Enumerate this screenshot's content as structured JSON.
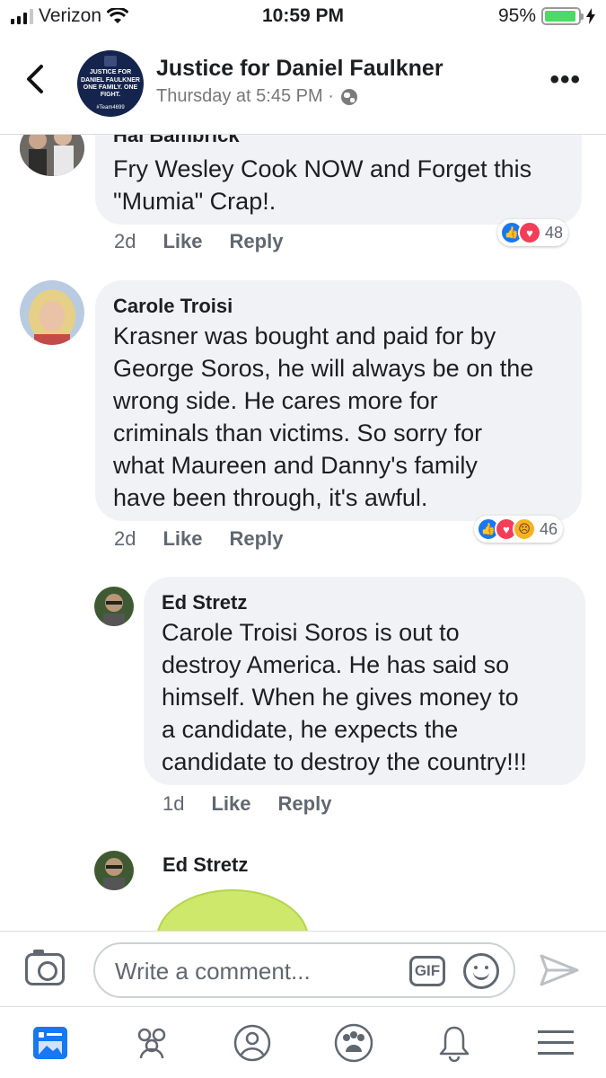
{
  "status_bar": {
    "carrier": "Verizon",
    "time": "10:59 PM",
    "battery": "95%",
    "battery_level": 0.95
  },
  "header": {
    "title": "Justice for Daniel Faulkner",
    "subtitle": "Thursday at 5:45 PM ·",
    "avatar_lines": [
      "JUSTICE FOR DANIEL FAULKNER",
      "ONE FAMILY. ONE FIGHT.",
      "#Team4699"
    ]
  },
  "comments": [
    {
      "name": "Hal Bambrick",
      "text_lines": [
        "Fry Wesley Cook NOW and Forget this",
        "\"Mumia\" Crap!."
      ],
      "age": "2d",
      "like": "Like",
      "reply": "Reply",
      "reactions": [
        "like-icon",
        "love-icon"
      ],
      "reaction_count": "48"
    },
    {
      "name": "Carole Troisi",
      "text_lines": [
        "Krasner was bought and paid for by",
        "George Soros, he will always be on the",
        "wrong side.  He cares more for",
        "criminals than victims.  So sorry for",
        "what Maureen and Danny's family",
        "have been through, it's awful."
      ],
      "age": "2d",
      "like": "Like",
      "reply": "Reply",
      "reactions": [
        "like-icon",
        "love-icon",
        "sad-icon"
      ],
      "reaction_count": "46"
    },
    {
      "name": "Ed Stretz",
      "text_lines": [
        "Carole Troisi Soros is out to",
        "destroy America. He has said so",
        "himself. When he gives money to",
        "a candidate, he expects the",
        "candidate to destroy the country!!!"
      ],
      "age": "1d",
      "like": "Like",
      "reply": "Reply"
    },
    {
      "name": "Ed Stretz"
    }
  ],
  "composer": {
    "placeholder": "Write a comment...",
    "gif": "GIF"
  },
  "tabs": [
    "news-feed-icon",
    "groups-icon",
    "profile-icon",
    "communities-icon",
    "notifications-icon",
    "menu-icon"
  ],
  "colors": {
    "like": "#1877f2",
    "love": "#f33e58",
    "sad": "#f7b125",
    "bubble": "#f0f2f5",
    "meta": "#606770"
  }
}
